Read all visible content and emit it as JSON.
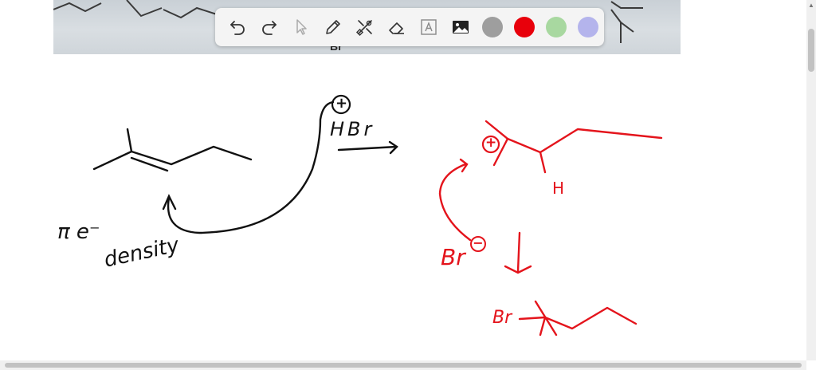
{
  "toolbar": {
    "tools": [
      {
        "name": "undo-icon",
        "label": "Undo"
      },
      {
        "name": "redo-icon",
        "label": "Redo"
      },
      {
        "name": "select-pointer-icon",
        "label": "Select"
      },
      {
        "name": "pen-icon",
        "label": "Pen"
      },
      {
        "name": "tools-icon",
        "label": "Tools"
      },
      {
        "name": "eraser-icon",
        "label": "Eraser"
      },
      {
        "name": "text-icon",
        "label": "Text"
      },
      {
        "name": "image-icon",
        "label": "Image"
      }
    ],
    "colors": [
      {
        "name": "color-gray",
        "hex": "#9e9e9e"
      },
      {
        "name": "color-red",
        "hex": "#e8000b"
      },
      {
        "name": "color-green",
        "hex": "#a8d8a0"
      },
      {
        "name": "color-purple",
        "hex": "#b4b4ec"
      }
    ]
  },
  "background_photo": {
    "visible_text": "Br"
  },
  "annotations": {
    "pi_electron_label": "π e⁻",
    "density_label": "density",
    "reagent_charge": "+",
    "reagent_label": "HBr",
    "carbocation_charge": "+",
    "hydrogen_label": "H",
    "bromide_label": "Br",
    "bromide_charge": "−",
    "product_br_label": "Br"
  },
  "colors": {
    "ink_black": "#111111",
    "ink_red": "#e4141c"
  }
}
